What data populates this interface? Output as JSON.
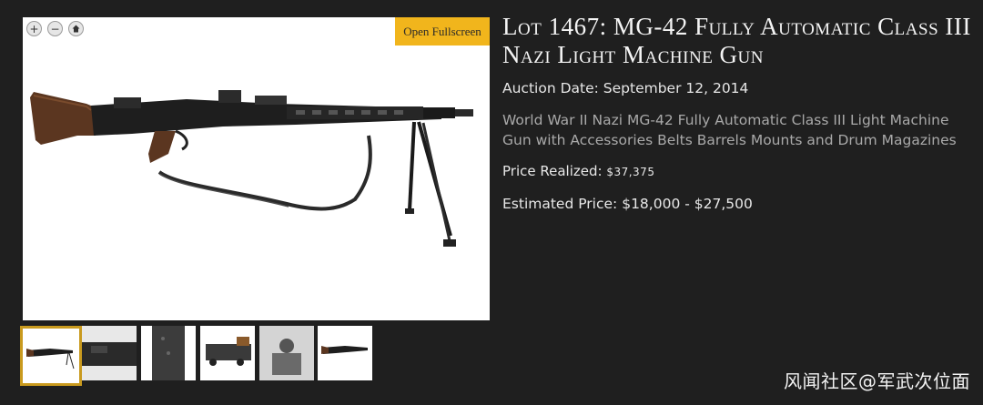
{
  "viewer": {
    "zoom_in": "+",
    "zoom_out": "−",
    "fullscreen_label": "Open Fullscreen"
  },
  "lot": {
    "title": "Lot 1467: MG-42 Fully Automatic Class III Nazi Light Machine Gun",
    "auction_date_label": "Auction Date:",
    "auction_date": "September 12, 2014",
    "description": "World War II Nazi MG-42 Fully Automatic Class III Light Machine Gun with Accessories Belts Barrels Mounts and Drum Magazines",
    "price_realized_label": "Price Realized:",
    "price_realized": "$37,375",
    "estimated_label": "Estimated Price:",
    "estimated_range": "$18,000 - $27,500"
  },
  "watermark": "风闻社区@军武次位面",
  "colors": {
    "background": "#1f1f1f",
    "accent": "#f1b51c",
    "thumb_active_border": "#c99a1e"
  }
}
